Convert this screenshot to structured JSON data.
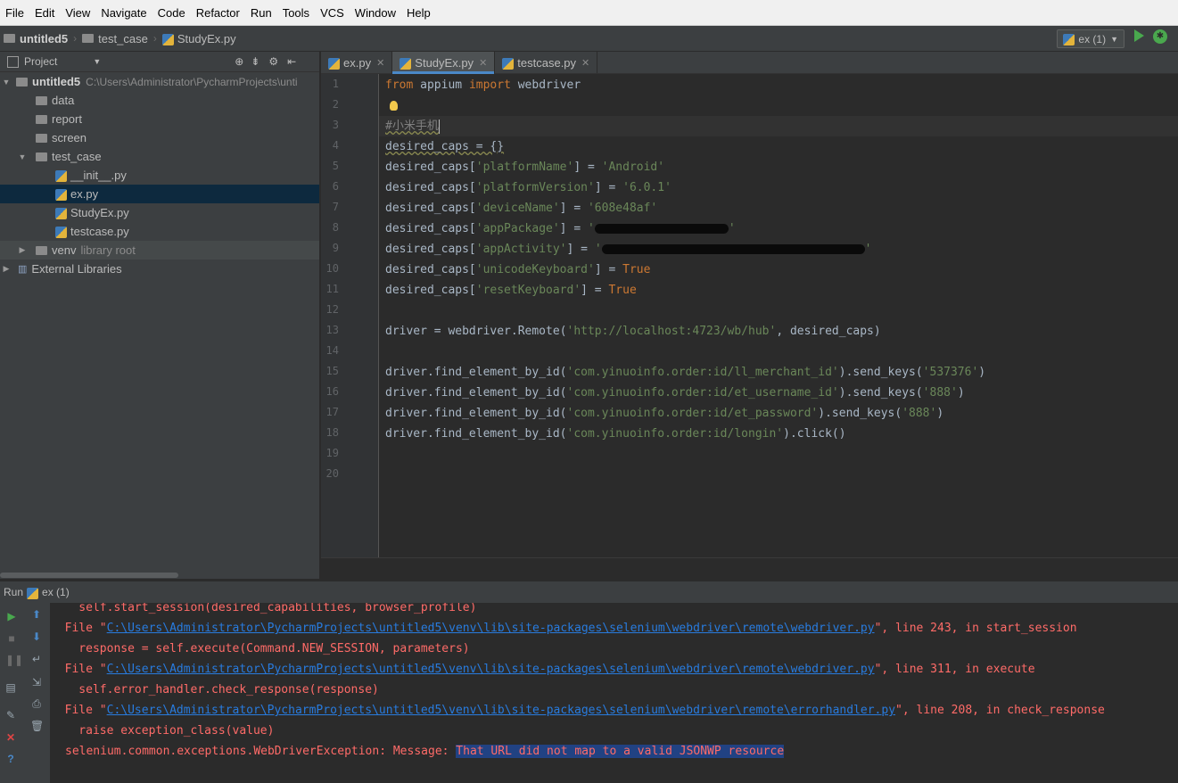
{
  "menu": [
    "File",
    "Edit",
    "View",
    "Navigate",
    "Code",
    "Refactor",
    "Run",
    "Tools",
    "VCS",
    "Window",
    "Help"
  ],
  "breadcrumb": {
    "project": "untitled5",
    "folder": "test_case",
    "file": "StudyEx.py"
  },
  "run_config": {
    "name": "ex (1)"
  },
  "project_panel": {
    "title": "Project",
    "tree": {
      "root": {
        "name": "untitled5",
        "path": "C:\\Users\\Administrator\\PycharmProjects\\unti"
      },
      "data": "data",
      "report": "report",
      "screen": "screen",
      "test_case": "test_case",
      "init": "__init__.py",
      "ex": "ex.py",
      "studyex": "StudyEx.py",
      "testcase": "testcase.py",
      "venv": "venv",
      "venv_note": "library root",
      "external": "External Libraries"
    }
  },
  "tabs": [
    "ex.py",
    "StudyEx.py",
    "testcase.py"
  ],
  "active_tab": "StudyEx.py",
  "editor": {
    "line_numbers": [
      "1",
      "2",
      "3",
      "4",
      "5",
      "6",
      "7",
      "8",
      "9",
      "10",
      "11",
      "12",
      "13",
      "14",
      "15",
      "16",
      "17",
      "18",
      "19",
      "20"
    ],
    "l1": {
      "kw1": "from",
      "mod": " appium ",
      "kw2": "import",
      "rest": " webdriver"
    },
    "l3": "#小米手机",
    "l4": "desired_caps = {}",
    "caps": [
      {
        "key": "'platformName'",
        "val": "'Android'"
      },
      {
        "key": "'platformVersion'",
        "val": "'6.0.1'"
      },
      {
        "key": "'deviceName'",
        "val": "'608e48af'"
      },
      {
        "key": "'appPackage'",
        "val": "'"
      },
      {
        "key": "'appActivity'",
        "val": "'"
      }
    ],
    "l10": {
      "key": "'unicodeKeyboard'",
      "val": "True"
    },
    "l11": {
      "key": "'resetKeyboard'",
      "val": "True"
    },
    "l13": {
      "pre": "driver = webdriver.Remote(",
      "url": "'http://localhost:4723/wb/hub'",
      "post": ", desired_caps)"
    },
    "finds": [
      {
        "pre": "driver.find_element_by_id(",
        "id": "'com.yinuoinfo.order:id/ll_merchant_id'",
        "post": ").send_keys(",
        "arg": "'537376'",
        "end": ")"
      },
      {
        "pre": "driver.find_element_by_id(",
        "id": "'com.yinuoinfo.order:id/et_username_id'",
        "post": ").send_keys(",
        "arg": "'888'",
        "end": ")"
      },
      {
        "pre": "driver.find_element_by_id(",
        "id": "'com.yinuoinfo.order:id/et_password'",
        "post": ").send_keys(",
        "arg": "'888'",
        "end": ")"
      },
      {
        "pre": "driver.find_element_by_id(",
        "id": "'com.yinuoinfo.order:id/longin'",
        "post": ").click()",
        "arg": "",
        "end": ""
      }
    ]
  },
  "run_panel": {
    "label": "Run",
    "config": "ex (1)",
    "output": {
      "l1": "    self.start_session(desired_capabilities, browser_profile)",
      "f1": {
        "pre": "  File \"",
        "path": "C:\\Users\\Administrator\\PycharmProjects\\untitled5\\venv\\lib\\site-packages\\selenium\\webdriver\\remote\\webdriver.py",
        "post": "\", line 243, in start_session"
      },
      "l3": "    response = self.execute(Command.NEW_SESSION, parameters)",
      "f2": {
        "pre": "  File \"",
        "path": "C:\\Users\\Administrator\\PycharmProjects\\untitled5\\venv\\lib\\site-packages\\selenium\\webdriver\\remote\\webdriver.py",
        "post": "\", line 311, in execute"
      },
      "l5": "    self.error_handler.check_response(response)",
      "f3": {
        "pre": "  File \"",
        "path": "C:\\Users\\Administrator\\PycharmProjects\\untitled5\\venv\\lib\\site-packages\\selenium\\webdriver\\remote\\errorhandler.py",
        "post": "\", line 208, in check_response"
      },
      "l7": "    raise exception_class(value)",
      "err_prefix": "selenium.common.exceptions.WebDriverException: Message: ",
      "err_msg": "That URL did not map to a valid JSONWP resource"
    }
  },
  "colors": {
    "keyword": "#cc7832",
    "string": "#6a8759",
    "error": "#ff6b68",
    "link": "#287bde",
    "selection": "#214283"
  }
}
